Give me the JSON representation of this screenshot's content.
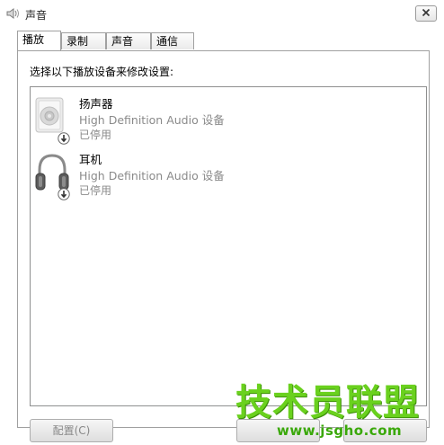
{
  "window": {
    "title": "声音",
    "icon": "speaker-icon",
    "close_icon": "close-icon"
  },
  "tabs": [
    {
      "label": "播放",
      "active": true
    },
    {
      "label": "录制",
      "active": false
    },
    {
      "label": "声音",
      "active": false
    },
    {
      "label": "通信",
      "active": false
    }
  ],
  "panel": {
    "instruction": "选择以下播放设备来修改设置:"
  },
  "devices": [
    {
      "name": "扬声器",
      "description": "High Definition Audio 设备",
      "status": "已停用",
      "icon": "speaker-device-icon",
      "status_icon": "disabled-arrow-icon"
    },
    {
      "name": "耳机",
      "description": "High Definition Audio 设备",
      "status": "已停用",
      "icon": "headphones-icon",
      "status_icon": "disabled-arrow-icon"
    }
  ],
  "buttons": {
    "configure": "配置(C)"
  },
  "watermark": {
    "main": "技术员联盟",
    "url": "www.jsgho.com"
  },
  "colors": {
    "accent_green": "#6ad11e",
    "disabled_text": "#8a8a8a"
  }
}
